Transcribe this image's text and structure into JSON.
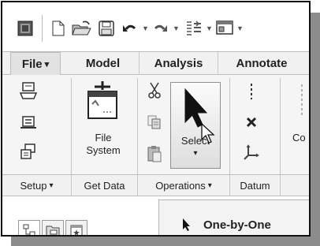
{
  "menu": {
    "tabs": [
      "File",
      "Model",
      "Analysis",
      "Annotate"
    ],
    "file_arrow": "▾"
  },
  "quick_access": {
    "icons": [
      "window-icon",
      "new-file-icon",
      "open-folder-icon",
      "save-icon",
      "undo-icon",
      "redo-icon",
      "regenerate-icon",
      "windows-icon"
    ]
  },
  "ribbon": {
    "file_system_label": "File\nSystem",
    "file_system_line1": "File",
    "file_system_line2": "System",
    "select_label": "Select",
    "select_arrow": "▾",
    "clipped_label": "Co"
  },
  "groups": [
    {
      "label": "Setup",
      "arrow": "▾"
    },
    {
      "label": "Get Data",
      "arrow": ""
    },
    {
      "label": "Operations",
      "arrow": "▾"
    },
    {
      "label": "Datum",
      "arrow": ""
    }
  ],
  "dropdown": {
    "item": "One-by-One"
  },
  "colors": {
    "ribbon_bg": "#f5f5f5",
    "tab_bg": "#f1f1f1",
    "shadow": "#8c8c8c"
  }
}
